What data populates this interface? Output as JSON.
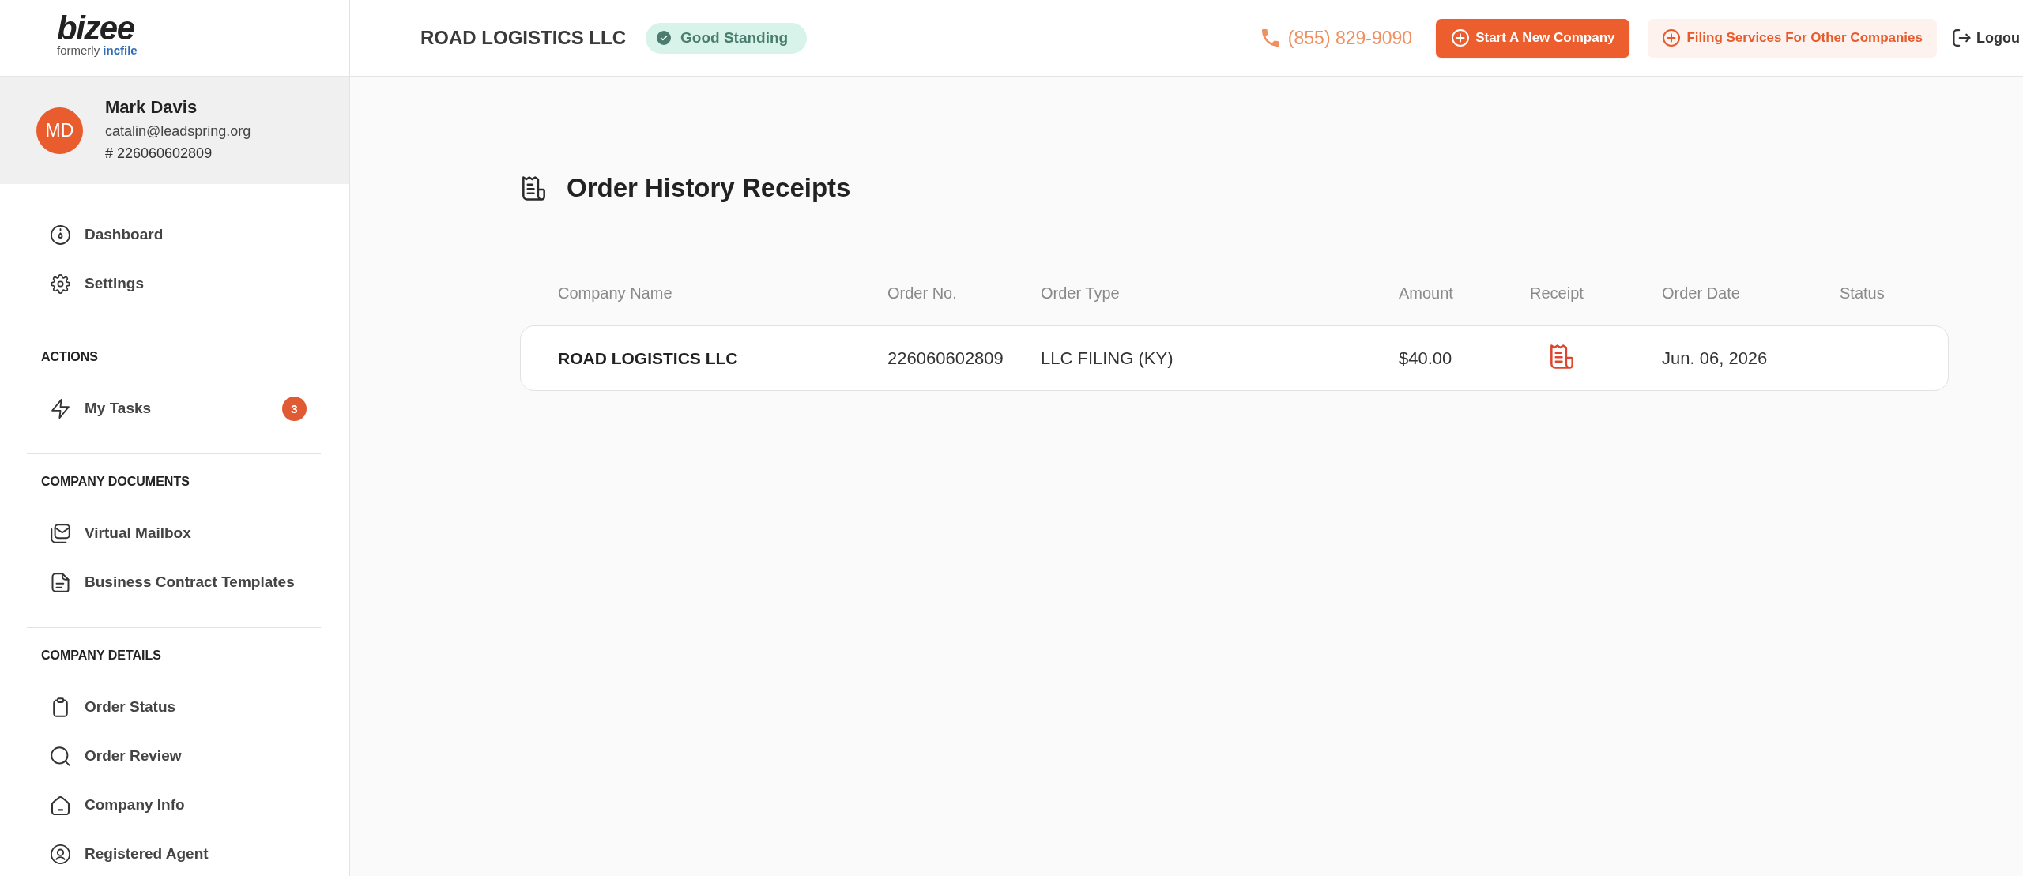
{
  "logo": {
    "wordmark": "bizee",
    "tagline": "formerly **incfile**"
  },
  "user": {
    "initials": "MD",
    "name": "Mark Davis",
    "email": "catalin@leadspring.org",
    "account_number": "# 226060602809"
  },
  "sidebar": {
    "sections": [
      {
        "items": [
          {
            "label": "Dashboard"
          },
          {
            "label": "Settings"
          }
        ]
      },
      {
        "heading": "ACTIONS",
        "items": [
          {
            "label": "My Tasks",
            "badge": "3"
          }
        ]
      },
      {
        "heading": "COMPANY DOCUMENTS",
        "items": [
          {
            "label": "Virtual Mailbox"
          },
          {
            "label": "Business Contract Templates"
          }
        ]
      },
      {
        "heading": "COMPANY DETAILS",
        "items": [
          {
            "label": "Order Status"
          },
          {
            "label": "Order Review"
          },
          {
            "label": "Company Info"
          },
          {
            "label": "Registered Agent"
          }
        ]
      }
    ]
  },
  "header": {
    "company_name": "ROAD LOGISTICS LLC",
    "standing": "Good Standing",
    "phone": "(855) 829-9090",
    "buttons": [
      {
        "kind": "primary",
        "label": "Start A New Company"
      },
      {
        "kind": "secondary",
        "label": "Filing Services For Other Companies"
      }
    ],
    "logout": "Logou"
  },
  "page": {
    "title": "Order History Receipts"
  },
  "table": {
    "columns": [
      "Company Name",
      "Order No.",
      "Order Type",
      "Amount",
      "Receipt",
      "Order Date",
      "Status"
    ],
    "rows": [
      {
        "company_name": "ROAD LOGISTICS LLC",
        "order_no": "226060602809",
        "order_type": "LLC FILING (KY)",
        "amount": "$40.00",
        "order_date": "Jun. 06, 2026"
      }
    ]
  }
}
